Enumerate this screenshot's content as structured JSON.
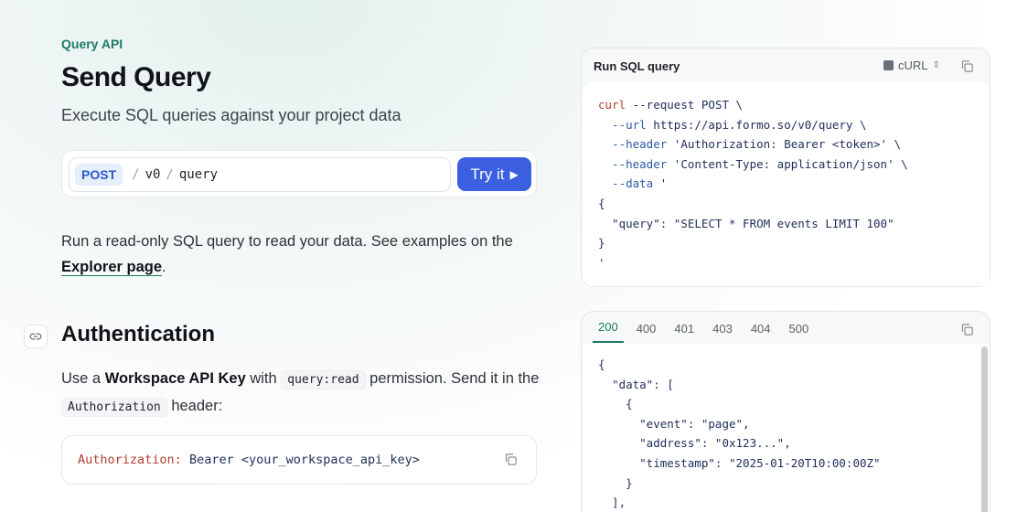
{
  "header": {
    "eyebrow": "Query API",
    "title": "Send Query",
    "subtitle": "Execute SQL queries against your project data"
  },
  "endpoint": {
    "method": "POST",
    "path_segments": [
      "v0",
      "query"
    ],
    "try_label": "Try it"
  },
  "description": {
    "text": "Run a read-only SQL query to read your data. See examples on the ",
    "link": "Explorer page",
    "suffix": "."
  },
  "auth": {
    "heading": "Authentication",
    "intro": "Use a ",
    "key_name": "Workspace API Key",
    "with": " with ",
    "permission": "query:read",
    "after_perm": " permission. Send it in the ",
    "header_name": "Authorization",
    "after_header": " header:",
    "code_key": "Authorization:",
    "code_value": "Bearer <your_workspace_api_key>"
  },
  "request_panel": {
    "title": "Run SQL query",
    "language": "cURL",
    "lines": {
      "l1a": "curl",
      "l1b": " --request POST \\",
      "l2a": "  --url",
      "l2b": " https://api.formo.so/v0/query \\",
      "l3a": "  --header",
      "l3b": " 'Authorization: Bearer <token>' \\",
      "l4a": "  --header",
      "l4b": " 'Content-Type: application/json' \\",
      "l5a": "  --data",
      "l5b": " '",
      "l6": "{",
      "l7": "  \"query\": \"SELECT * FROM events LIMIT 100\"",
      "l8": "}",
      "l9": "'"
    }
  },
  "response_panel": {
    "tabs": [
      "200",
      "400",
      "401",
      "403",
      "404",
      "500"
    ],
    "active_tab": "200",
    "lines": [
      "{",
      "  \"data\": [",
      "    {",
      "      \"event\": \"page\",",
      "      \"address\": \"0x123...\",",
      "      \"timestamp\": \"2025-01-20T10:00:00Z\"",
      "    }",
      "  ],"
    ]
  },
  "colors": {
    "accent": "#1f7a67",
    "button": "#3b5fe0",
    "method_badge_bg": "#e6eefb",
    "method_badge_text": "#2a5bc7"
  }
}
